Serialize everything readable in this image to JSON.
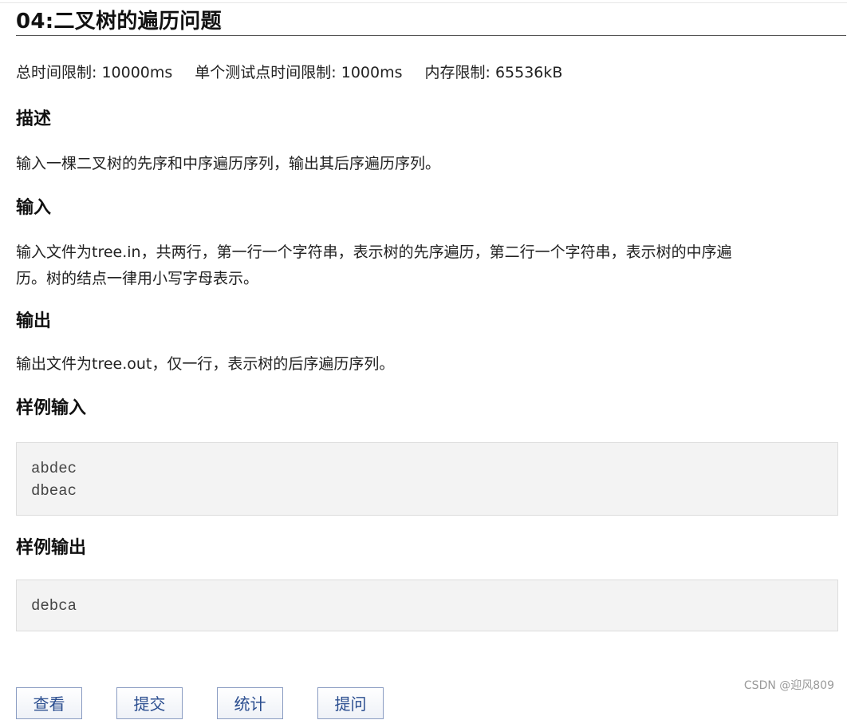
{
  "problem": {
    "title": "04:二叉树的遍历问题",
    "limits": [
      "总时间限制: 10000ms",
      "单个测试点时间限制: 1000ms",
      "内存限制: 65536kB"
    ]
  },
  "sections": {
    "description": {
      "heading": "描述",
      "text": "输入一棵二叉树的先序和中序遍历序列，输出其后序遍历序列。"
    },
    "input": {
      "heading": "输入",
      "line1": "输入文件为tree.in，共两行，第一行一个字符串，表示树的先序遍历，第二行一个字符串，表示树的中序遍",
      "line2": "历。树的结点一律用小写字母表示。"
    },
    "output": {
      "heading": "输出",
      "text": "输出文件为tree.out，仅一行，表示树的后序遍历序列。"
    },
    "sample_input": {
      "heading": "样例输入",
      "lines": [
        "abdec",
        "dbeac"
      ]
    },
    "sample_output": {
      "heading": "样例输出",
      "lines": [
        "debca"
      ]
    }
  },
  "buttons": [
    "查看",
    "提交",
    "统计",
    "提问"
  ],
  "watermark": "CSDN @迎风809",
  "colors": {
    "code_bg": "#f3f3f3",
    "button_text": "#2a4d8f",
    "heading": "#111111"
  }
}
